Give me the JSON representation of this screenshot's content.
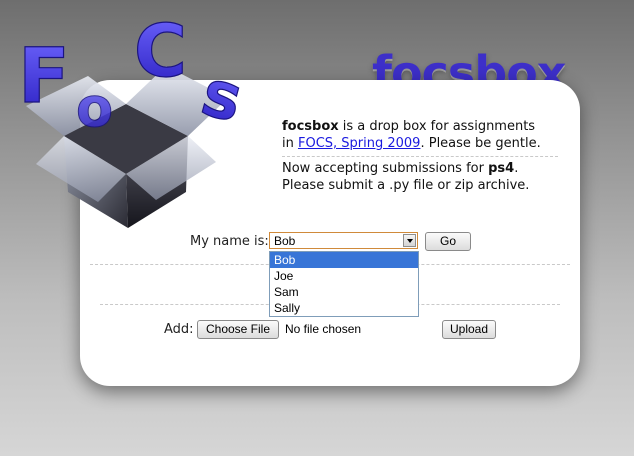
{
  "brand": {
    "title": "focsbox",
    "logo_text": "FOCS"
  },
  "intro": {
    "name": "focsbox",
    "text1": " is a drop box for assignments in ",
    "link": "FOCS, Spring 2009",
    "text2": ". Please be gentle.",
    "accept_prefix": "Now accepting submissions for ",
    "problem_set": "ps4",
    "accept_suffix": ". Please submit a .py file or zip archive."
  },
  "name_form": {
    "label": "My name is:",
    "selected": "Bob",
    "options": [
      "Bob",
      "Joe",
      "Sam",
      "Sally"
    ],
    "go_label": "Go"
  },
  "upload_form": {
    "label": "Add:",
    "choose_label": "Choose File",
    "no_file": "No file chosen",
    "upload_label": "Upload"
  },
  "colors": {
    "brand": "#3d2fc9",
    "link": "#1a1adf",
    "highlight": "#3875d7"
  }
}
